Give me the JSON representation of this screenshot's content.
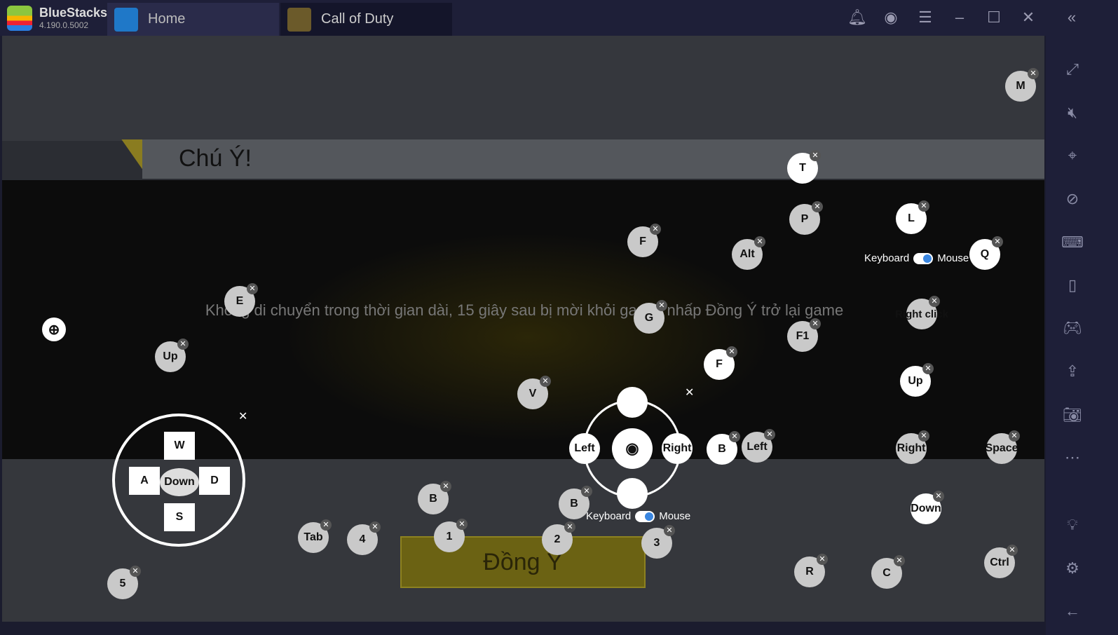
{
  "titlebar": {
    "brand": "BlueStacks",
    "version": "4.190.0.5002",
    "tabs": [
      {
        "label": "Home"
      },
      {
        "label": "Call of Duty"
      }
    ],
    "icons": [
      "bell-icon",
      "account-icon",
      "menu-icon",
      "minimize-icon",
      "maximize-icon",
      "close-icon",
      "collapse-icon"
    ]
  },
  "game": {
    "dialog_title": "Chú Ý!",
    "message": "Không di chuyển trong thời gian dài, 15 giây sau bị mời khỏi game, nhấp Đồng Ý trở lại game",
    "ok_label": "Đồng Ý"
  },
  "controls": {
    "keys": [
      "M",
      "T",
      "P",
      "Q",
      "F",
      "Alt",
      "E",
      "G",
      "Right click",
      "F1",
      "F",
      "Up",
      "Up",
      "V",
      "B",
      "Left",
      "Right",
      "Space",
      "Down",
      "B",
      "B",
      "Tab",
      "4",
      "1",
      "2",
      "3",
      "5",
      "R",
      "C",
      "Ctrl",
      "L"
    ],
    "dpad": {
      "up": "W",
      "left": "A",
      "center": "Down",
      "right": "D",
      "down": "S"
    },
    "dpad2": {
      "left": "Left",
      "right": "Right"
    },
    "toggle_keyboard": "Keyboard",
    "toggle_mouse": "Mouse"
  },
  "sidebar": {
    "icons": [
      "fullscreen-icon",
      "mute-icon",
      "pointer-lock-icon",
      "eye-off-icon",
      "keyboard-icon",
      "phone-icon",
      "gamepad-icon",
      "import-icon",
      "camera-icon",
      "more-icon",
      "light-bulb-icon",
      "settings-icon",
      "back-icon"
    ]
  }
}
